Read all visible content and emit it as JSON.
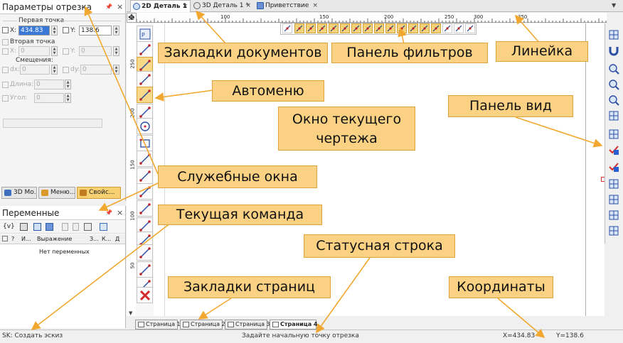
{
  "params_panel": {
    "title": "Параметры отрезка",
    "first_point": "Первая точка",
    "x_label": "X:",
    "x_value": "434.83",
    "y_label": "Y:",
    "y_value": "138.6",
    "second_point": "Вторая точка",
    "x2_label": "X:",
    "x2_value": "0",
    "y2_label": "Y:",
    "y2_value": "0",
    "offsets": "Смещения:",
    "dx_label": "dx:",
    "dx_value": "0",
    "dy_label": "dy:",
    "dy_value": "0",
    "length_label": "Длина:",
    "length_value": "0",
    "angle_label": "Угол:",
    "angle_value": "0",
    "tabs": [
      "3D Мо...",
      "Меню...",
      "Свойс..."
    ]
  },
  "variables_panel": {
    "title": "Переменные",
    "columns": [
      "?",
      "И...",
      "Выражение",
      "З...",
      "К...",
      "Д"
    ],
    "empty_text": "Нет переменных"
  },
  "doc_tabs": [
    {
      "label": "2D Деталь 1",
      "close": "×"
    },
    {
      "label": "3D Деталь 1 *",
      "close": "×"
    },
    {
      "label": "Приветствие",
      "close": "×"
    }
  ],
  "ruler": {
    "ticks": [
      {
        "label": "50"
      },
      {
        "label": "100"
      },
      {
        "label": "150"
      },
      {
        "label": "200"
      },
      {
        "label": "250"
      },
      {
        "label": "300"
      },
      {
        "label": "350"
      }
    ],
    "vticks": [
      {
        "label": "250"
      },
      {
        "label": "200"
      },
      {
        "label": "150"
      },
      {
        "label": "100"
      },
      {
        "label": "50"
      }
    ]
  },
  "page_tabs": [
    "Страница 1",
    "Страница 2",
    "Страница 3",
    "Страница 4"
  ],
  "status_bar": {
    "command": "SK: Создать эскиз",
    "prompt": "Задайте начальную точку отрезка",
    "x": "X=434.83",
    "y": "Y=138.6"
  },
  "callouts": {
    "doc_tabs": "Закладки документов",
    "filters": "Панель фильтров",
    "ruler": "Линейка",
    "automenu": "Автоменю",
    "drawing": "Окно текущего\nчертежа",
    "view_panel": "Панель вид",
    "service_windows": "Служебные окна",
    "current_command": "Текущая команда",
    "status_line": "Статусная строка",
    "page_tabs": "Закладки страниц",
    "coordinates": "Координаты"
  },
  "colors": {
    "callout_bg": "#fbd284",
    "callout_border": "#e0a23a",
    "arrow": "#f2a830",
    "selected_tool": "#f8d98a"
  }
}
